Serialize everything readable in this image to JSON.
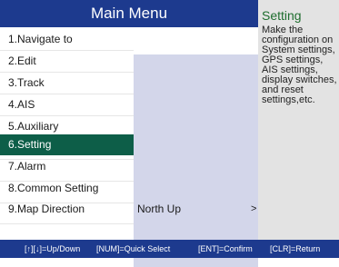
{
  "title": "Main Menu",
  "menu": {
    "items": [
      {
        "label": "1.Navigate to",
        "value": "",
        "arrow": ""
      },
      {
        "label": "2.Edit",
        "value": "",
        "arrow": ""
      },
      {
        "label": "3.Track",
        "value": "",
        "arrow": ""
      },
      {
        "label": "4.AIS",
        "value": "",
        "arrow": ""
      },
      {
        "label": "5.Auxiliary",
        "value": "",
        "arrow": ""
      },
      {
        "label": "6.Setting",
        "value": "",
        "arrow": ""
      },
      {
        "label": "7.Alarm",
        "value": "",
        "arrow": ""
      },
      {
        "label": "8.Common Setting",
        "value": "",
        "arrow": ""
      },
      {
        "label": "9.Map Direction",
        "value": "North Up",
        "arrow": ">"
      }
    ],
    "selected_index": 5
  },
  "help": {
    "title": "Setting",
    "text": "Make the configuration on System settings, GPS settings, AIS settings, display switches, and reset settings,etc."
  },
  "footer": {
    "hints": [
      "[↑][↓]=Up/Down",
      "[NUM]=Quick Select",
      "[ENT]=Confirm",
      "[CLR]=Return"
    ]
  },
  "colors": {
    "title_bg": "#1d3a8e",
    "selected_bg": "#0d5e48",
    "value_column_bg": "#d3d6ea",
    "help_bg": "#e3e3e3",
    "help_title": "#1f6e2f"
  }
}
